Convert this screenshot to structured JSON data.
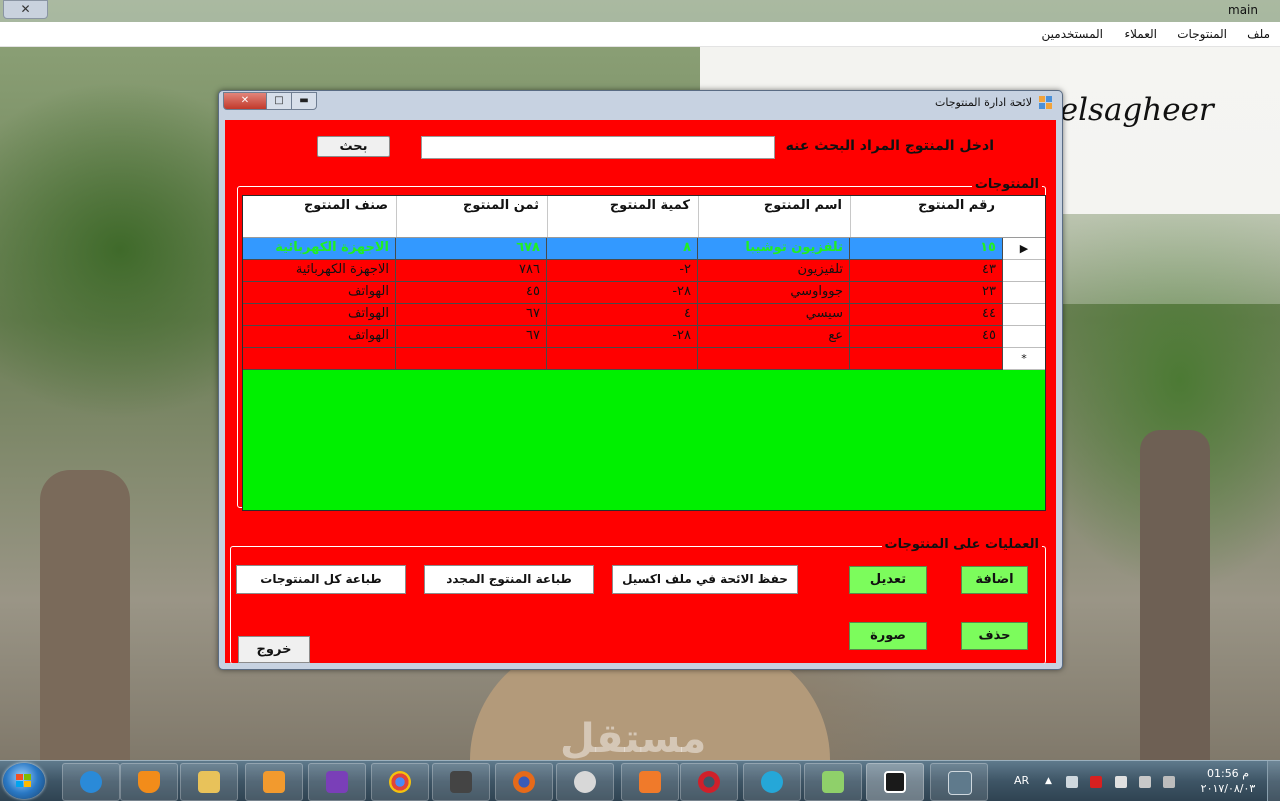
{
  "window": {
    "title": "main",
    "close_label": "✕"
  },
  "menu": [
    "ملف",
    "المنتوجات",
    "العملاء",
    "المستخدمين"
  ],
  "background_text": "l elsagheer",
  "dialog": {
    "title": "لائحة ادارة المنتوجات",
    "close_label": "✕",
    "max_label": "□",
    "min_label": "▬",
    "search": {
      "label": "ادخل المنتوج المراد البحث عنه",
      "button": "بحث",
      "value": ""
    },
    "products_group": "المنتوجات",
    "grid": {
      "columns": [
        "رقم المنتوج",
        "اسم المنتوج",
        "كمية المنتوج",
        "ثمن المنتوج",
        "صنف المنتوج"
      ],
      "rows": [
        {
          "id": "١٥",
          "name": "تلفزيون توشيبا",
          "qty": "٨",
          "price": "٦٧٨",
          "category": "الاجهزة الكهربائية",
          "marker": "▶"
        },
        {
          "id": "٤٣",
          "name": "تلفيزيون",
          "qty": "٢-",
          "price": "٧٨٦",
          "category": "الاجهزة الكهربائية",
          "marker": ""
        },
        {
          "id": "٢٣",
          "name": "جوواوسي",
          "qty": "٢٨-",
          "price": "٤٥",
          "category": "الهواتف",
          "marker": ""
        },
        {
          "id": "٤٤",
          "name": "سيسي",
          "qty": "٤",
          "price": "٦٧",
          "category": "الهواتف",
          "marker": ""
        },
        {
          "id": "٤٥",
          "name": "عع",
          "qty": "٢٨-",
          "price": "٦٧",
          "category": "الهواتف",
          "marker": ""
        },
        {
          "id": "",
          "name": "",
          "qty": "",
          "price": "",
          "category": "",
          "marker": "*"
        }
      ],
      "selected_row": 0
    },
    "operations_group": "العمليات على المنتوجات",
    "buttons": {
      "add": "اضافة",
      "edit": "تعديل",
      "delete": "حذف",
      "image": "صورة",
      "save_excel": "حفظ الائحة في ملف اكسيل",
      "print_new": "طباعة المنتوج المجدد",
      "print_all": "طباعة كل المنتوجات",
      "exit": "خروج"
    }
  },
  "taskbar": {
    "language": "AR",
    "time": "01:56 م",
    "date": "٢٠١٧/٠٨/٠٣",
    "apps": [
      "internet-explorer",
      "vlc",
      "file-explorer",
      "media-player",
      "visual-studio",
      "chrome",
      "media-player-classic",
      "firefox",
      "screen-recorder",
      "pdf-tool",
      "opera",
      "video-converter",
      "snipping-tool",
      "briefcase",
      "window-app"
    ]
  },
  "watermark": "مستقل",
  "colors": {
    "form_bg": "#ff0000",
    "grid_bg": "#00f000",
    "selected_row": "#3399ff",
    "green_button": "#7cfc5c"
  }
}
